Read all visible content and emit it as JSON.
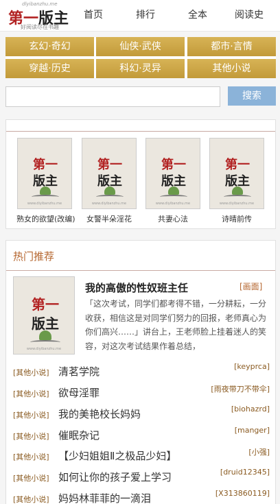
{
  "header": {
    "logo_small": "dlyibanzhu.me",
    "logo_main_1": "第一",
    "logo_main_2": "版主",
    "logo_sub": "好阅读尽在书趣",
    "nav": [
      "首页",
      "排行",
      "全本",
      "阅读史"
    ]
  },
  "categories": [
    "玄幻·奇幻",
    "仙侠·武侠",
    "都市·言情",
    "穿越·历史",
    "科幻·灵异",
    "其他小说"
  ],
  "search": {
    "placeholder": "",
    "button_label": "搜索"
  },
  "cover_text": {
    "line1": "第一",
    "line2": "版主",
    "url": "www.diyibanzhu.me"
  },
  "featured_books": [
    {
      "title": "熟女的欲望(改编)"
    },
    {
      "title": "女警半朵淫花"
    },
    {
      "title": "共妻心法"
    },
    {
      "title": "诗晴前传"
    }
  ],
  "hot": {
    "section_title": "热门推荐",
    "top": {
      "title": "我的高傲的性奴班主任",
      "tag": "[画面]",
      "description": "「这次考试，同学们都考得不错，一分耕耘，一分收获，相信这是对同学们努力的回报，老师真心为你们高兴……」讲台上，王老师脸上挂着迷人的笑容，对这次考试结果作着总结，"
    },
    "list": [
      {
        "category": "[其他小说]",
        "title": "清茗学院",
        "author": "[keyprca]"
      },
      {
        "category": "[其他小说]",
        "title": "欲母淫罪",
        "author": "[雨夜带刀不带伞]"
      },
      {
        "category": "[其他小说]",
        "title": "我的美艳校长妈妈",
        "author": "[biohazrd]"
      },
      {
        "category": "[其他小说]",
        "title": "催眠杂记",
        "author": "[manger]"
      },
      {
        "category": "[其他小说]",
        "title": "【少妇姐姐Ⅱ之极品少妇】",
        "author": "[小强]"
      },
      {
        "category": "[其他小说]",
        "title": "如何让你的孩子爱上学习",
        "author": "[druid12345]"
      },
      {
        "category": "[其他小说]",
        "title": "妈妈林菲菲的一滴泪",
        "author": "[X313860119]"
      }
    ]
  }
}
